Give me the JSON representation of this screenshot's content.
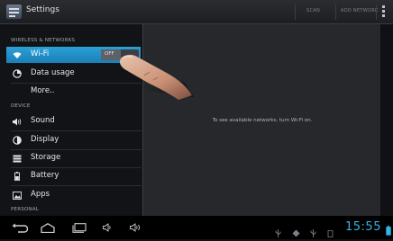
{
  "actionbar": {
    "title": "Settings",
    "scan_label": "SCAN",
    "add_network_label": "ADD NETWORK"
  },
  "sidebar": {
    "wireless_header": "WIRELESS & NETWORKS",
    "wifi": {
      "label": "Wi-Fi",
      "toggle": "OFF"
    },
    "data_usage": "Data usage",
    "more": "More..",
    "device_header": "DEVICE",
    "sound": "Sound",
    "display": "Display",
    "storage": "Storage",
    "battery": "Battery",
    "apps": "Apps",
    "personal_header": "PERSONAL"
  },
  "content": {
    "message": "To see available networks, turn Wi-Fi on."
  },
  "statusbar": {
    "time": "15:55"
  },
  "icons": [
    "settings-icon",
    "wifi-icon",
    "data-usage-icon",
    "sound-icon",
    "display-icon",
    "storage-icon",
    "battery-icon",
    "apps-icon",
    "back-icon",
    "home-icon",
    "recent-apps-icon",
    "volume-down-icon",
    "volume-up-icon",
    "usb-icon",
    "sd-card-icon",
    "battery-status-icon"
  ],
  "colors": {
    "accent": "#33b5e5",
    "selected_row": "#1a7fb8"
  }
}
